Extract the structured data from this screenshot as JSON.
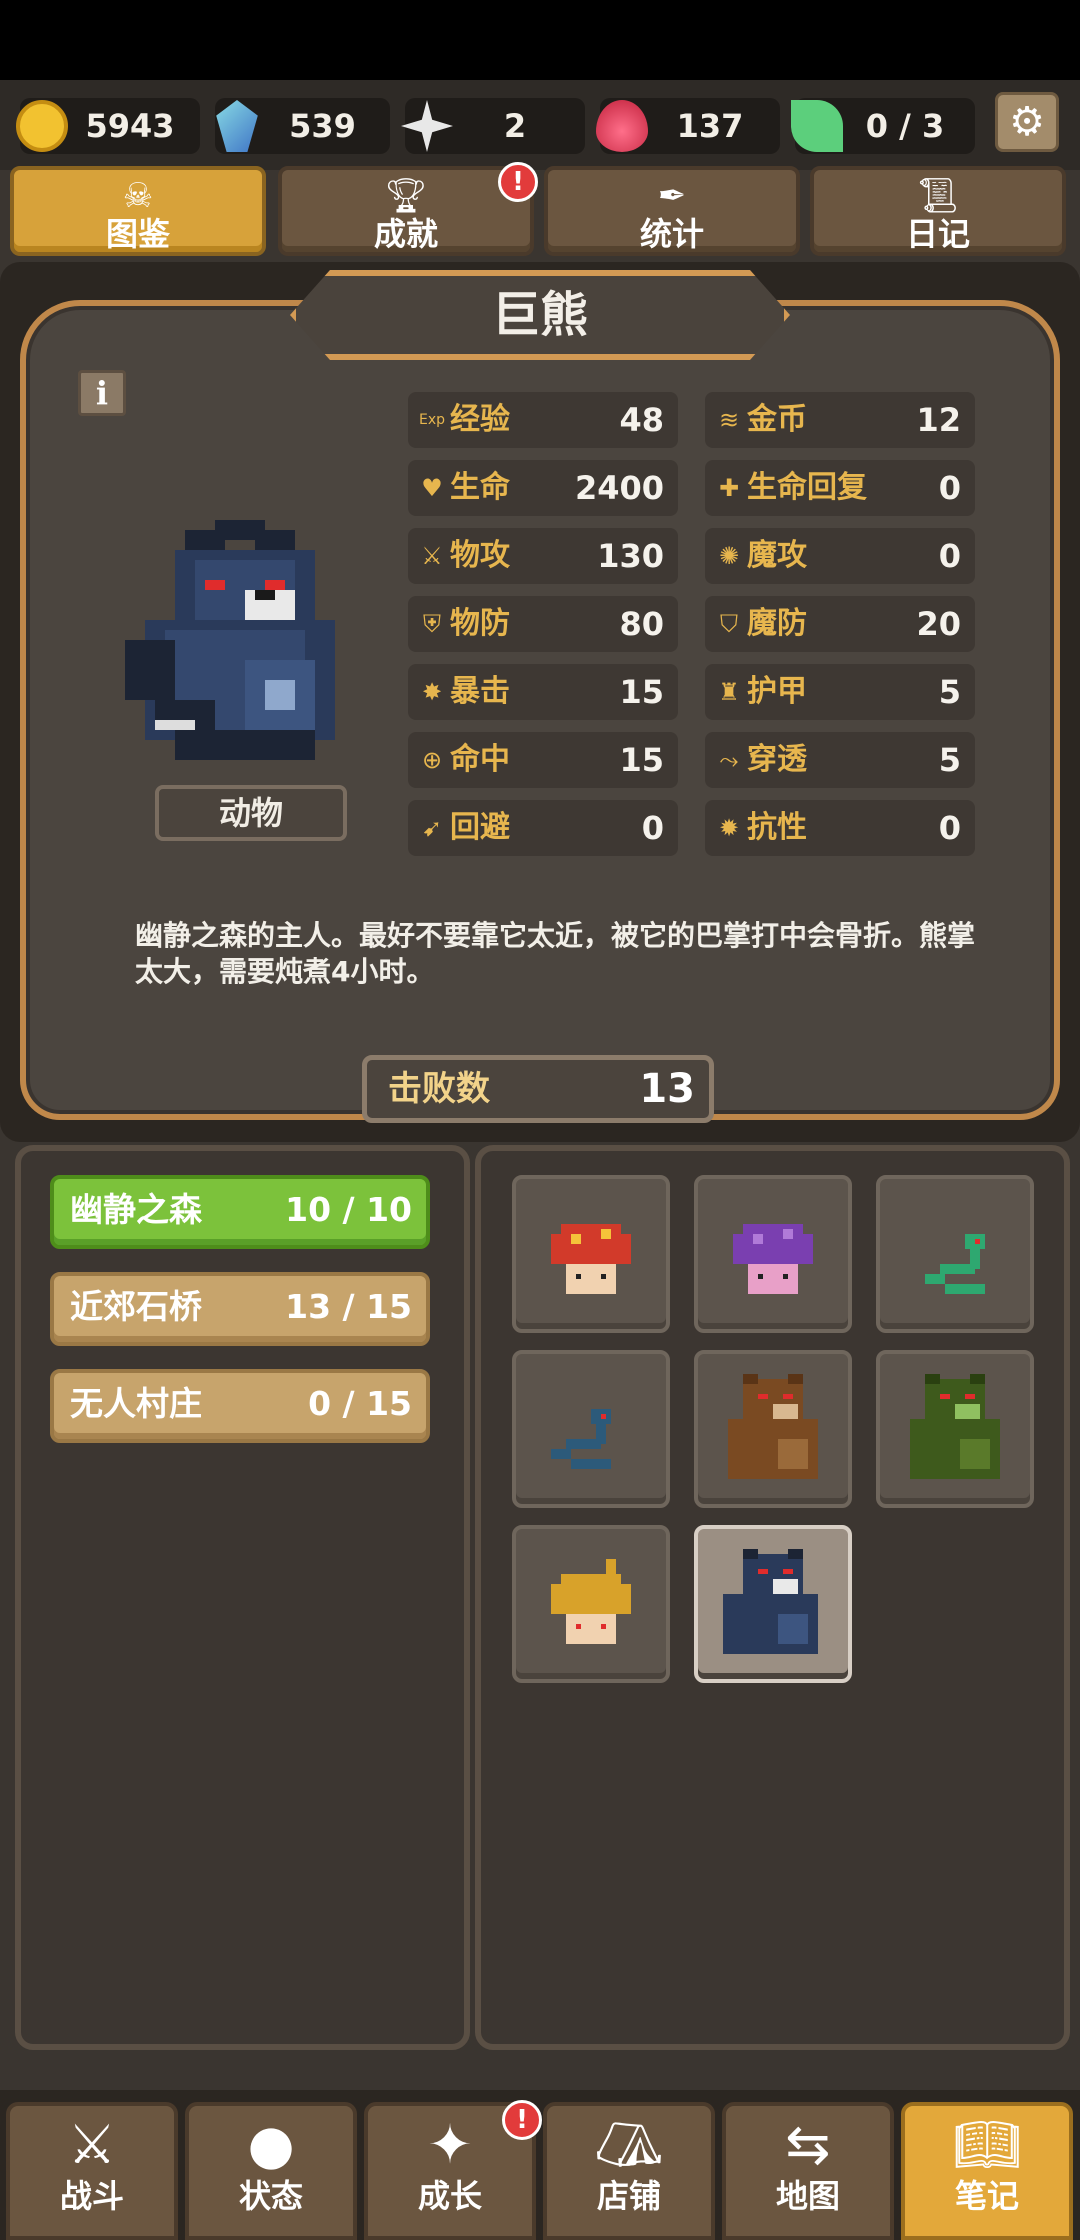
{
  "resources": [
    {
      "name": "gold",
      "icon": "gold-coin-icon",
      "value": "5943",
      "color": "#f2c230"
    },
    {
      "name": "crystal",
      "icon": "crystal-icon",
      "value": "539",
      "color": "#5fa0d8"
    },
    {
      "name": "star",
      "icon": "star-burst-icon",
      "value": "2",
      "color": "#dddddd"
    },
    {
      "name": "soul",
      "icon": "soul-flame-icon",
      "value": "137",
      "color": "#d8344a"
    },
    {
      "name": "leaf",
      "icon": "leaf-icon",
      "value": "0 / 3",
      "color": "#5ccf7c"
    }
  ],
  "top_tabs": [
    {
      "label": "图鉴",
      "icon": "skull-icon",
      "active": true
    },
    {
      "label": "成就",
      "icon": "trophy-icon",
      "badge": "!"
    },
    {
      "label": "统计",
      "icon": "quill-icon"
    },
    {
      "label": "日记",
      "icon": "scroll-icon"
    }
  ],
  "monster": {
    "name": "巨熊",
    "type": "动物",
    "description": "幽静之森的主人。最好不要靠它太近，被它的巴掌打中会骨折。熊掌太大，需要炖煮4小时。",
    "kills_label": "击败数",
    "kills": "13",
    "info_symbol": "i"
  },
  "stats_left": [
    {
      "label": "经验",
      "value": "48",
      "icon": "exp-icon",
      "glyph": "Exp"
    },
    {
      "label": "生命",
      "value": "2400",
      "icon": "heart-icon",
      "glyph": "♥"
    },
    {
      "label": "物攻",
      "value": "130",
      "icon": "sword-icon",
      "glyph": "⚔"
    },
    {
      "label": "物防",
      "value": "80",
      "icon": "shield-icon",
      "glyph": "⛨"
    },
    {
      "label": "暴击",
      "value": "15",
      "icon": "crit-icon",
      "glyph": "✸"
    },
    {
      "label": "命中",
      "value": "15",
      "icon": "crosshair-icon",
      "glyph": "⊕"
    },
    {
      "label": "回避",
      "value": "0",
      "icon": "dodge-icon",
      "glyph": "➹"
    }
  ],
  "stats_right": [
    {
      "label": "金币",
      "value": "12",
      "icon": "coins-icon",
      "glyph": "≋"
    },
    {
      "label": "生命回复",
      "value": "0",
      "icon": "heart-plus-icon",
      "glyph": "✚"
    },
    {
      "label": "魔攻",
      "value": "0",
      "icon": "magic-swirl-icon",
      "glyph": "✺"
    },
    {
      "label": "魔防",
      "value": "20",
      "icon": "magic-shield-icon",
      "glyph": "⛉"
    },
    {
      "label": "护甲",
      "value": "5",
      "icon": "armor-icon",
      "glyph": "♜"
    },
    {
      "label": "穿透",
      "value": "5",
      "icon": "pierce-icon",
      "glyph": "⤳"
    },
    {
      "label": "抗性",
      "value": "0",
      "icon": "resist-icon",
      "glyph": "✹"
    }
  ],
  "regions": [
    {
      "name": "幽静之森",
      "count": "10 / 10",
      "active": true
    },
    {
      "name": "近郊石桥",
      "count": "13 / 15"
    },
    {
      "name": "无人村庄",
      "count": "0 / 15"
    }
  ],
  "monsters_grid": [
    {
      "icon": "red-mushroom-icon"
    },
    {
      "icon": "purple-mushroom-icon"
    },
    {
      "icon": "green-snake-icon"
    },
    {
      "icon": "blue-snake-icon"
    },
    {
      "icon": "brown-bear-icon"
    },
    {
      "icon": "green-bear-icon"
    },
    {
      "icon": "yellow-mushroom-icon"
    },
    {
      "icon": "giant-bear-icon",
      "active": true
    }
  ],
  "bottom_nav": [
    {
      "label": "战斗",
      "icon": "crossed-swords-icon"
    },
    {
      "label": "状态",
      "icon": "person-icon"
    },
    {
      "label": "成长",
      "icon": "sparkle-icon",
      "badge": "!"
    },
    {
      "label": "店铺",
      "icon": "tent-icon"
    },
    {
      "label": "地图",
      "icon": "signpost-icon"
    },
    {
      "label": "笔记",
      "icon": "open-book-icon",
      "active": true
    }
  ],
  "settings": {
    "icon": "gear-icon"
  }
}
